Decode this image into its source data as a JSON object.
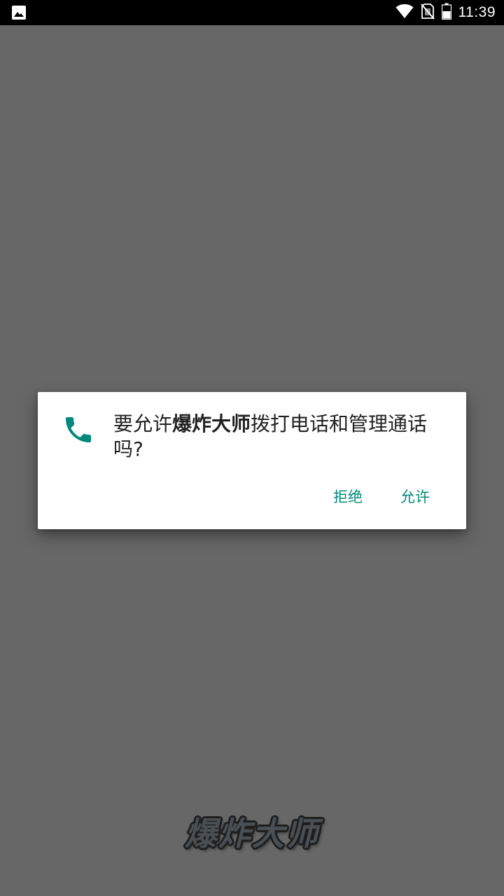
{
  "status_bar": {
    "time": "11:39",
    "icons": [
      "image-notification-icon",
      "wifi-icon",
      "no-sim-icon",
      "battery-icon"
    ]
  },
  "dialog": {
    "icon": "phone-icon",
    "message_prefix": "要允许",
    "app_name": "爆炸大师",
    "message_suffix": "拨打电话和管理通话吗?",
    "deny_label": "拒绝",
    "allow_label": "允许",
    "accent_color": "#00897b"
  },
  "splash": {
    "logo_text": "爆炸大师"
  },
  "colors": {
    "scrim": "#676767",
    "status_bar": "#000000",
    "dialog_bg": "#ffffff"
  }
}
